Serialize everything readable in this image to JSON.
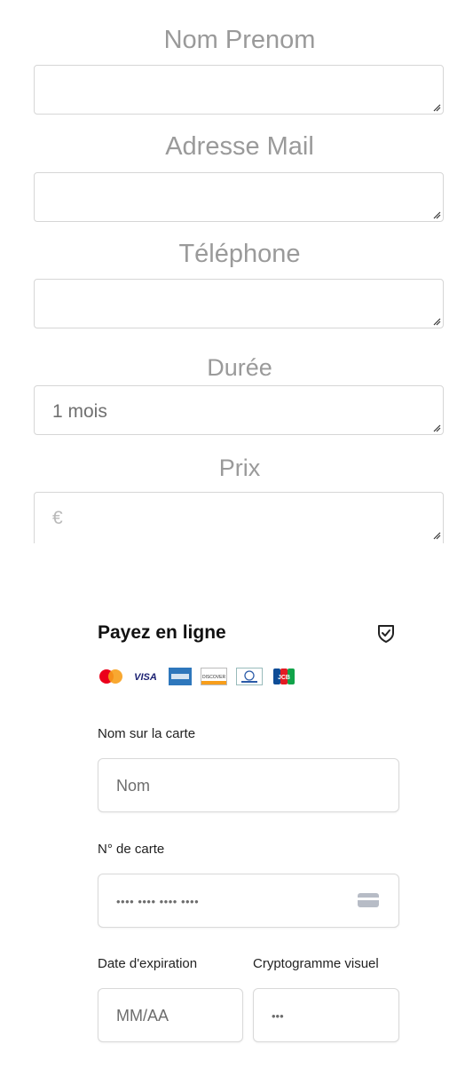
{
  "form": {
    "name_label": "Nom Prenom",
    "email_label": "Adresse Mail",
    "phone_label": "Téléphone",
    "duration_label": "Durée",
    "duration_value": "1 mois",
    "price_label": "Prix",
    "price_value": "€"
  },
  "payment": {
    "title": "Payez en ligne",
    "card_brands": [
      "mastercard-icon",
      "visa-icon",
      "amex-icon",
      "discover-icon",
      "diners-icon",
      "jcb-icon"
    ],
    "visa_text": "VISA",
    "discover_text": "DISCOVER",
    "jcb_text": "JCB",
    "card_name_label": "Nom sur la carte",
    "card_name_placeholder": "Nom",
    "card_number_label": "N° de carte",
    "card_number_placeholder": "•••• •••• •••• ••••",
    "expiry_label": "Date d'expiration",
    "expiry_placeholder": "MM/AA",
    "cvv_label": "Cryptogramme visuel",
    "cvv_placeholder": "•••"
  },
  "colors": {
    "label_gray": "#9a9a9a",
    "border": "#d6d6d6",
    "mastercard_red": "#eb001b",
    "mastercard_orange": "#f79e1b",
    "visa_blue": "#1a1f71",
    "amex_blue": "#2e77bc"
  }
}
